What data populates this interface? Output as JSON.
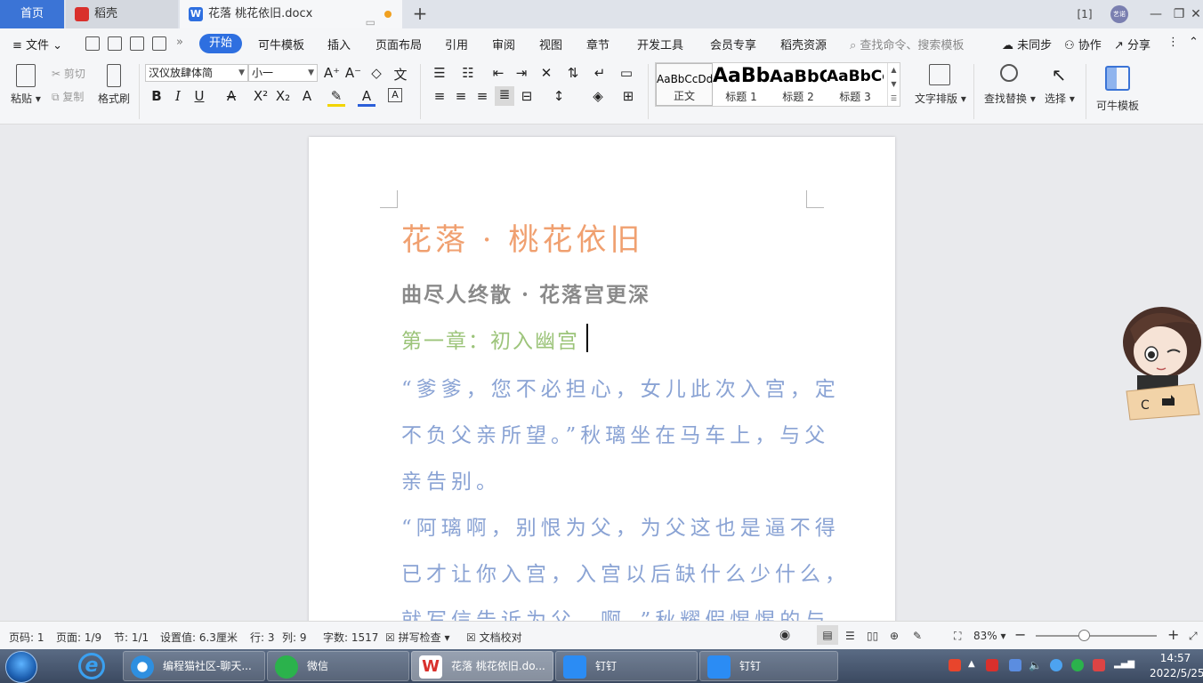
{
  "tabs": {
    "home": "首页",
    "daoke": "稻壳",
    "doc": "花落 桃花依旧.docx",
    "avatar": "艺诺"
  },
  "menu": {
    "file": "文件",
    "start": "开始",
    "items": [
      "可牛模板",
      "插入",
      "页面布局",
      "引用",
      "审阅",
      "视图",
      "章节",
      "开发工具",
      "会员专享",
      "稻壳资源"
    ],
    "search_placeholder": "查找命令、搜索模板",
    "sync": "未同步",
    "collab": "协作",
    "share": "分享"
  },
  "ribbon": {
    "paste": "粘贴",
    "cut": "剪切",
    "copy": "复制",
    "format_painter": "格式刷",
    "font_name": "汉仪放肆体简",
    "font_size": "小一",
    "styles": [
      {
        "sample": "AaBbCcDd",
        "name": "正文"
      },
      {
        "sample": "AaBb",
        "name": "标题 1"
      },
      {
        "sample": "AaBbC",
        "name": "标题 2"
      },
      {
        "sample": "AaBbCc",
        "name": "标题 3"
      }
    ],
    "text_layout": "文字排版",
    "find_replace": "查找替换",
    "select": "选择",
    "template": "可牛模板"
  },
  "document": {
    "title": "花落 · 桃花依旧",
    "subtitle": "曲尽人终散 · 花落宫更深",
    "chapter": "第一章：初入幽宫",
    "lines": [
      "“爹爹，您不必担心，女儿此次入宫，定",
      "不负父亲所望。”秋璃坐在马车上，与父",
      "亲告别。",
      "“阿璃啊，别恨为父，为父这也是逼不得",
      "已才让你入宫，入宫以后缺什么少什么，",
      "就写信告诉为父，啊。”秋耀假惺惺的与"
    ]
  },
  "status": {
    "page_num": "页码: 1",
    "pages": "页面: 1/9",
    "section": "节: 1/1",
    "setting": "设置值: 6.3厘米",
    "row": "行: 3",
    "col": "列: 9",
    "word_count": "字数: 1517",
    "spell_check": "拼写检查",
    "doc_proof": "文档校对",
    "zoom": "83%"
  },
  "taskbar": {
    "items": [
      "编程猫社区-聊天...",
      "微信",
      "花落 桃花依旧.do...",
      "钉钉",
      "钉钉"
    ],
    "time": "14:57",
    "date": "2022/5/25"
  }
}
